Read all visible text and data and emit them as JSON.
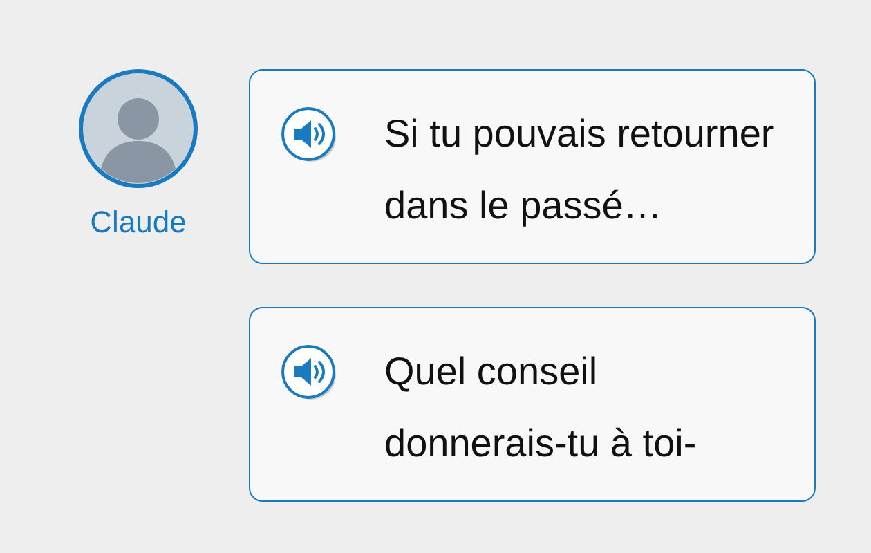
{
  "messages": [
    {
      "speaker": "Claude",
      "text": "Si tu pouvais retourner dans le passé…"
    },
    {
      "text": "Quel conseil donnerais-tu à toi-"
    }
  ]
}
